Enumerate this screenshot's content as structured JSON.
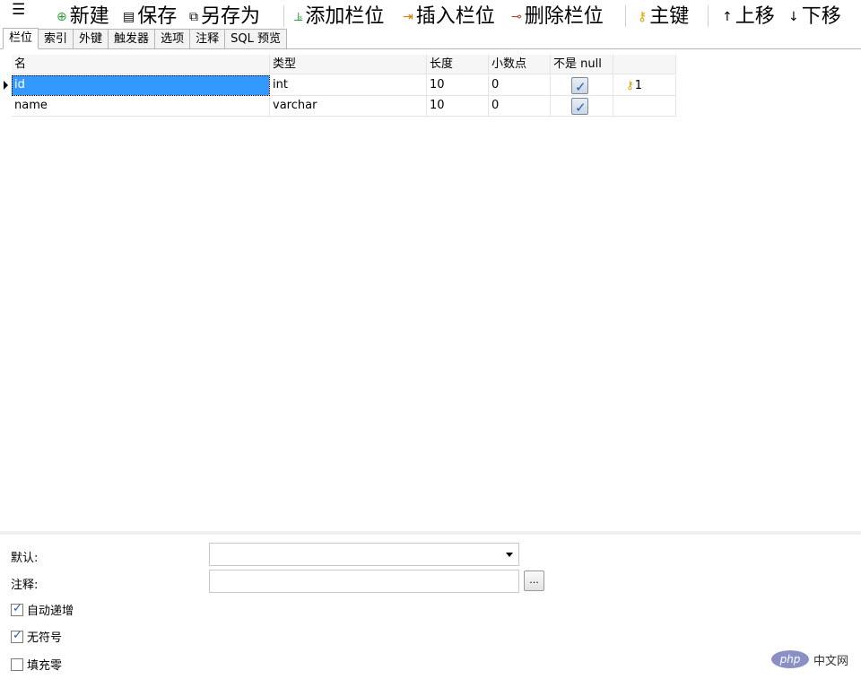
{
  "toolbar": {
    "menu_icon": "hamburger-icon",
    "new_label": "新建",
    "save_label": "保存",
    "save_as_label": "另存为",
    "add_field_label": "添加栏位",
    "insert_field_label": "插入栏位",
    "delete_field_label": "删除栏位",
    "primary_key_label": "主键",
    "move_up_label": "上移",
    "move_down_label": "下移"
  },
  "tabs": [
    {
      "label": "栏位",
      "active": true
    },
    {
      "label": "索引"
    },
    {
      "label": "外键"
    },
    {
      "label": "触发器"
    },
    {
      "label": "选项"
    },
    {
      "label": "注释"
    },
    {
      "label": "SQL 预览"
    }
  ],
  "grid": {
    "headers": [
      "名",
      "类型",
      "长度",
      "小数点",
      "不是 null",
      ""
    ],
    "rows": [
      {
        "name": "id",
        "type": "int",
        "length": "10",
        "decimals": "0",
        "not_null": true,
        "key": "1"
      },
      {
        "name": "name",
        "type": "varchar",
        "length": "10",
        "decimals": "0",
        "not_null": true,
        "key": ""
      }
    ]
  },
  "properties": {
    "default_label": "默认:",
    "default_value": "",
    "comment_label": "注释:",
    "comment_value": "",
    "comment_button": "...",
    "auto_increment_label": "自动递增",
    "auto_increment_checked": true,
    "unsigned_label": "无符号",
    "unsigned_checked": true,
    "zerofill_label": "填充零",
    "zerofill_checked": false
  },
  "watermark": {
    "logo": "php",
    "text": "中文网"
  },
  "colors": {
    "selection": "#3399ff",
    "key": "#d9a400"
  }
}
